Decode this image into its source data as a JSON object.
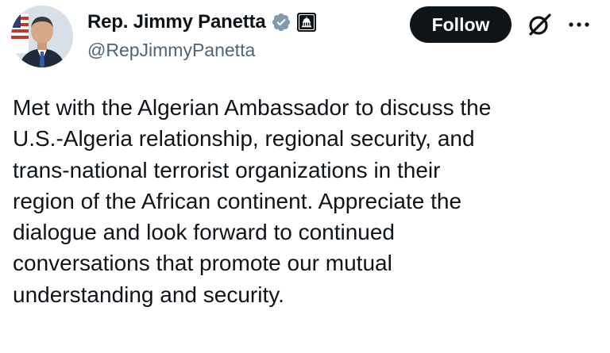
{
  "author": {
    "display_name": "Rep. Jimmy Panetta",
    "handle": "@RepJimmyPanetta",
    "verified_icon": "verified-badge-gray-icon",
    "affiliation_icon": "us-capitol-icon"
  },
  "actions": {
    "follow_label": "Follow",
    "grok_icon": "grok-icon",
    "more_icon": "more-horizontal-icon"
  },
  "tweet": {
    "lines": [
      "Met with the Algerian Ambassador to discuss the",
      "U.S.-Algeria relationship, regional security, and",
      "trans-national terrorist organizations in their",
      "region of the African continent. Appreciate the",
      "dialogue and look forward to continued",
      "conversations that promote our mutual",
      "understanding and security."
    ]
  },
  "colors": {
    "text": "#0f1419",
    "secondary_text": "#536471",
    "follow_button_bg": "#0f1419",
    "follow_button_text": "#ffffff",
    "verified_badge": "#829aab"
  }
}
